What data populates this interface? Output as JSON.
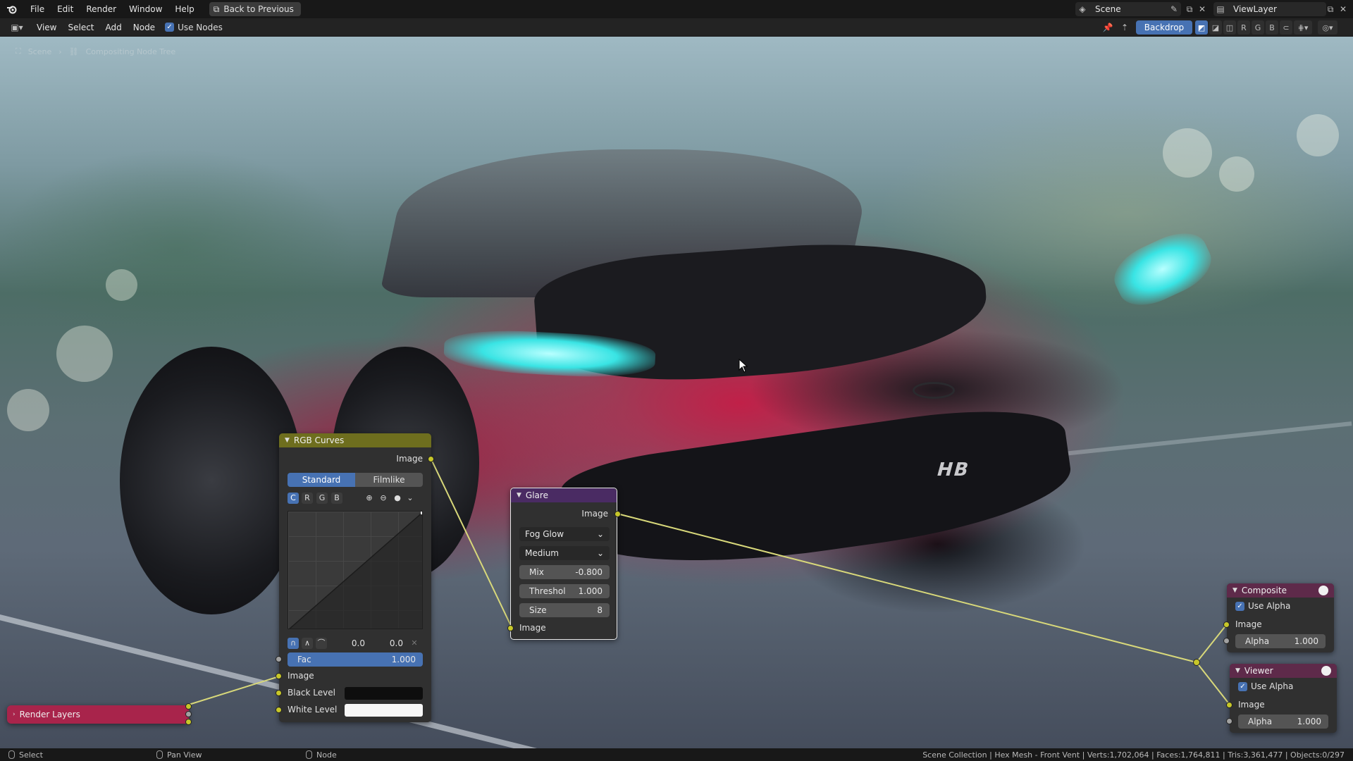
{
  "topbar": {
    "menus": [
      "File",
      "Edit",
      "Render",
      "Window",
      "Help"
    ],
    "back_button": "Back to Previous",
    "scene": "Scene",
    "view_layer": "ViewLayer"
  },
  "editor_header": {
    "menus": [
      "View",
      "Select",
      "Add",
      "Node"
    ],
    "use_nodes_label": "Use Nodes",
    "use_nodes_checked": true,
    "backdrop_label": "Backdrop",
    "channel_buttons": [
      "R",
      "G",
      "B"
    ]
  },
  "breadcrumb": [
    "Scene",
    "Compositing Node Tree"
  ],
  "nodes": {
    "rgb_curves": {
      "title": "RGB Curves",
      "output": "Image",
      "tabs": [
        "Standard",
        "Filmlike"
      ],
      "active_tab": "Standard",
      "channels": [
        "C",
        "R",
        "G",
        "B"
      ],
      "active_channel": "C",
      "curve_x": "0.0",
      "curve_y": "0.0",
      "fac_label": "Fac",
      "fac_value": "1.000",
      "inputs": [
        "Image",
        "Black Level",
        "White Level"
      ],
      "header_color": "#6e6e1e"
    },
    "glare": {
      "title": "Glare",
      "output": "Image",
      "type": "Fog Glow",
      "quality": "Medium",
      "mix_label": "Mix",
      "mix_value": "-0.800",
      "threshold_label": "Threshol",
      "threshold_value": "1.000",
      "size_label": "Size",
      "size_value": "8",
      "input": "Image",
      "header_color": "#4a2b63"
    },
    "composite": {
      "title": "Composite",
      "use_alpha_label": "Use Alpha",
      "input": "Image",
      "alpha_label": "Alpha",
      "alpha_value": "1.000",
      "header_color": "#5e2a4a"
    },
    "viewer": {
      "title": "Viewer",
      "use_alpha_label": "Use Alpha",
      "input": "Image",
      "alpha_label": "Alpha",
      "alpha_value": "1.000",
      "header_color": "#5e2a4a"
    },
    "render_layers": {
      "title": "Render Layers",
      "header_color": "#a8244b"
    }
  },
  "statusbar": {
    "select": "Select",
    "pan_view": "Pan View",
    "node": "Node",
    "info": "Scene Collection | Hex Mesh - Front Vent | Verts:1,702,064 | Faces:1,764,811 | Tris:3,361,477 | Objects:0/297"
  },
  "colors": {
    "accent": "#4772b3",
    "socket_color": "#c7c729",
    "wire_color": "#d8d87a"
  }
}
